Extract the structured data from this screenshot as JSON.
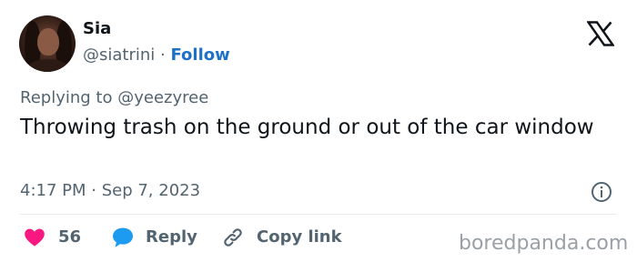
{
  "author": {
    "name": "Sia",
    "handle": "@siatrini",
    "separator": "·",
    "follow_label": "Follow"
  },
  "tweet": {
    "replying_prefix": "Replying to",
    "replying_to": "@yeezyree",
    "text": "Throwing trash on the ground or out of the car window",
    "timestamp": "4:17 PM · Sep 7, 2023"
  },
  "actions": {
    "like_count": "56",
    "reply_label": "Reply",
    "copy_label": "Copy link"
  },
  "icons": [
    "x-logo-icon",
    "info-icon",
    "heart-icon",
    "reply-bubble-icon",
    "link-icon"
  ],
  "colors": {
    "follow": "#1d71c9",
    "heart": "#f91880",
    "reply_bubble": "#1d9bf0",
    "secondary_text": "#536471",
    "watermark": "#9aa0a6"
  },
  "watermark": "boredpanda.com"
}
